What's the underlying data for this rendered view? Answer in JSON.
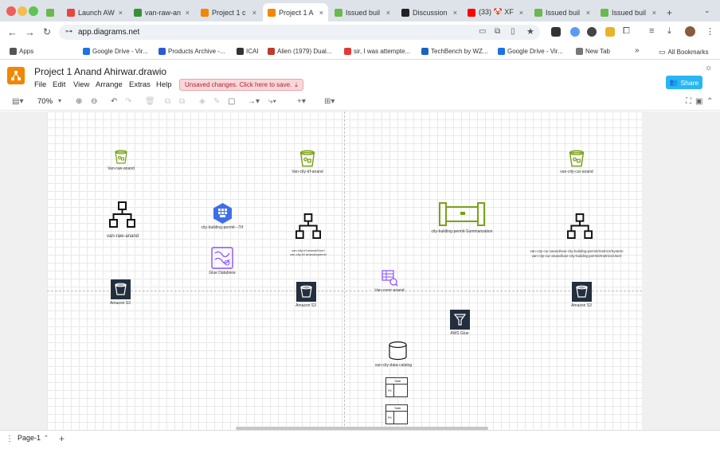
{
  "browser": {
    "tabs": [
      {
        "title": "Launch AW",
        "color": "#e8453c"
      },
      {
        "title": "van-raw-an",
        "color": "#3a8f3a"
      },
      {
        "title": "Project 1 c",
        "color": "#f08705"
      },
      {
        "title": "Project 1 A",
        "color": "#f08705"
      },
      {
        "title": "Issued buil",
        "color": "#6bb84f"
      },
      {
        "title": "Discussion",
        "color": "#222222"
      },
      {
        "title": "(33) 🤡 XF",
        "color": "#ff0000"
      },
      {
        "title": "Issued buil",
        "color": "#6bb84f"
      },
      {
        "title": "Issued buil",
        "color": "#6bb84f"
      }
    ],
    "new_tab": "+",
    "url": "app.diagrams.net",
    "bookmarks": [
      {
        "label": "Apps"
      },
      {
        "label": "Google Drive - Vir..."
      },
      {
        "label": "Products Archive -..."
      },
      {
        "label": "ICAI"
      },
      {
        "label": "Alien (1979) Dual..."
      },
      {
        "label": "sir, I was attempte..."
      },
      {
        "label": "TechBench by WZ..."
      },
      {
        "label": "Google Drive - Vir..."
      },
      {
        "label": "New Tab"
      }
    ],
    "more_bookmarks": "»",
    "all_bookmarks": "All Bookmarks"
  },
  "app": {
    "file_title": "Project 1 Anand Ahirwar.drawio",
    "menu": [
      "File",
      "Edit",
      "View",
      "Arrange",
      "Extras",
      "Help"
    ],
    "unsaved_text": "Unsaved changes. Click here to save.",
    "share_label": "Share",
    "zoom": "70%",
    "page_tab": "Page-1",
    "add_page": "+"
  },
  "diagram": {
    "labels": {
      "bucket_raw_top": "Van-raw-anand",
      "bucket_trf_top": "Van-city-trf-anand",
      "bucket_cur_top": "van-city-cur-anand",
      "hier_raw": "van-raw-anand",
      "hier_trf_1": "van-city-trf-anand/User/",
      "hier_trf_2": "van-city-trf-anand/system/",
      "hier_cur_1": "van-city-cur-anand/van-city-building-permit/metrics/System",
      "hier_cur_2": "van-city-cur-anand/van-city-building-permit/metrics/User/",
      "job_trf": "city-building-permit---Trf",
      "glue_databrew": "Glue Databrew",
      "summarization": "city-building-permit-Summarization",
      "crawler": "Van-crenr-anand",
      "s3_1": "Amazon S3",
      "s3_2": "Amazon S3",
      "s3_3": "Amazon S3",
      "aws_glue": "AWS Glue",
      "catalog": "van-city-data-catalog",
      "table_1_title": "Table",
      "table_1_pk": "PK",
      "table_2_title": "Table",
      "table_2_pk": "PK"
    }
  },
  "colors": {
    "bucket_green": "#7aa116",
    "job_blue": "#3f6ee8",
    "purple": "#8c4fff",
    "s3_dark": "#232f3e",
    "share_blue": "#29b6f2",
    "drawio_orange": "#f08705"
  }
}
